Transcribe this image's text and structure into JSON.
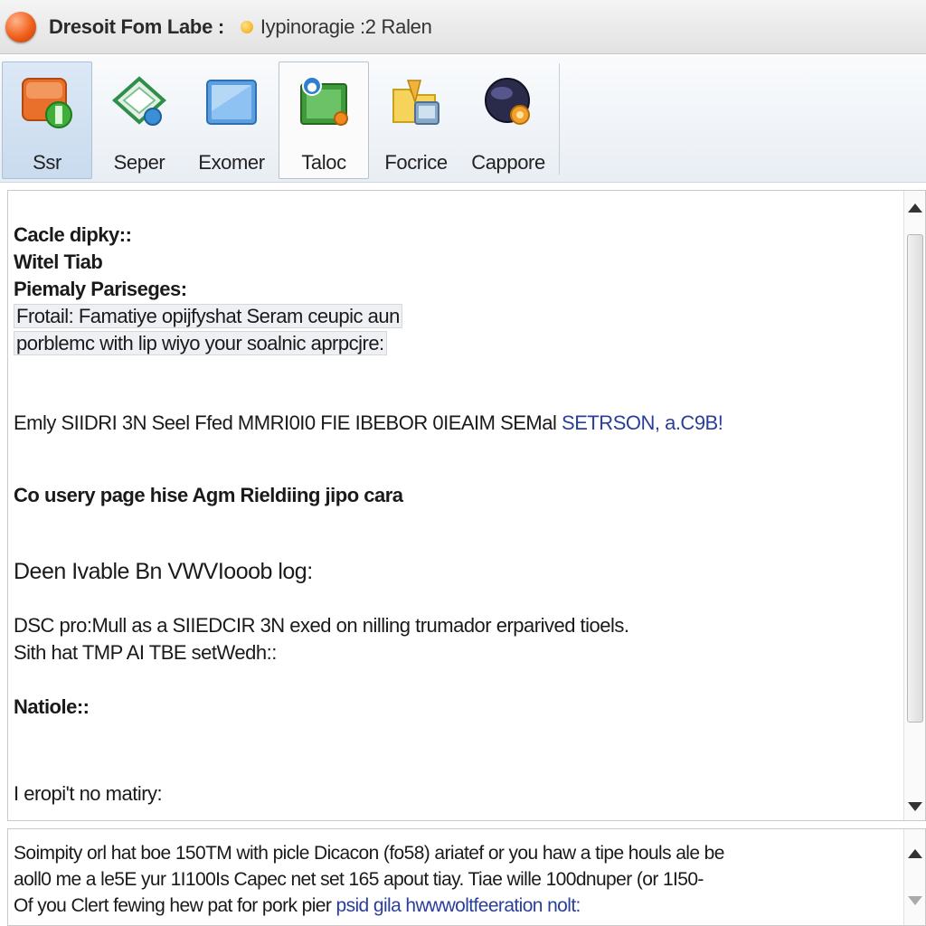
{
  "window": {
    "title": "Dresoit Fom Labe :",
    "subtitle": "Iypinoragie :2 Ralen"
  },
  "toolbar": {
    "items": [
      {
        "label": "Ssr",
        "icon": "orange-green-app-icon",
        "state": "pressed"
      },
      {
        "label": "Seper",
        "icon": "green-diamond-icon",
        "state": "normal"
      },
      {
        "label": "Exomer",
        "icon": "blue-window-icon",
        "state": "normal"
      },
      {
        "label": "Taloc",
        "icon": "green-board-icon",
        "state": "selected"
      },
      {
        "label": "Focrice",
        "icon": "yellow-folder-icon",
        "state": "normal"
      },
      {
        "label": "Cappore",
        "icon": "dark-orb-icon",
        "state": "normal"
      }
    ]
  },
  "document": {
    "lines": [
      {
        "text": "Cacle dipky::",
        "style": "bold"
      },
      {
        "text": "Witel Tiab",
        "style": "bold"
      },
      {
        "text": "Piemaly Pariseges:",
        "style": "bold"
      },
      {
        "text": "Frotail: Famatiye opijfyshat Seram ceupic aun",
        "style": "highlight"
      },
      {
        "text": "porblemc with lip wiyo your soalnic aprpcjre:",
        "style": "highlight"
      },
      {
        "text": "Emly SIIDRI 3N Seel Ffed MMRI0I0 FIE IBEBOR 0IEAIM SEMal",
        "style": "normal",
        "link": "SETRSON, a.C9B!"
      },
      {
        "text": "Co usery page hise Agm Rieldiing jipo cara",
        "style": "bold"
      },
      {
        "text": "Deen Ivable Bn VWVIooob log:",
        "style": "big"
      },
      {
        "text": "DSC pro:Mull as a SIIEDCIR 3N exed on nilling trumador erparived tioels.",
        "style": "normal"
      },
      {
        "text": "Sith hat TMP AI TBE setWedh::",
        "style": "normal"
      },
      {
        "text": "Natiole::",
        "style": "bold"
      },
      {
        "text": "I eropi't no matiry:",
        "style": "normal"
      }
    ]
  },
  "preview": {
    "lines": [
      {
        "text": "Soimpity orl hat boe 150TM with picle Dicacon (fo58) ariatef or you haw a tipe houls ale be"
      },
      {
        "text": "aoll0 me a le5E yur 1I100Is Capec net set 165 apout tiay. Tiae wille 100dnuper (or 1I50-"
      },
      {
        "text": "Of you Clert fewing hew pat for pork pier",
        "link": "psid gila hwwwoltfeeration nolt:"
      }
    ]
  },
  "colors": {
    "accent": "#f0601c",
    "link": "#2a3f9a",
    "toolbar_bg": "#e9eef4"
  }
}
